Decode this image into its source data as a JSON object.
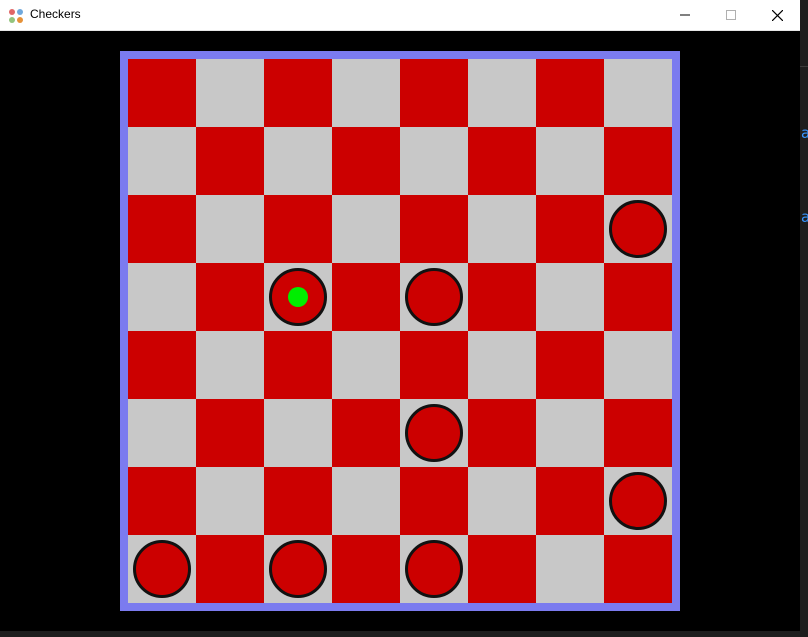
{
  "window": {
    "title": "Checkers",
    "icon": "checkers-app-icon",
    "minimize_icon": "minimize-icon",
    "maximize_icon": "maximize-icon",
    "close_icon": "close-icon"
  },
  "board": {
    "rows": 8,
    "cols": 8,
    "colors": {
      "dark_square": "#cc0000",
      "light_square": "#c8c8c8",
      "border": "#7b7bef",
      "piece_fill": "#cc0000",
      "piece_outline": "#111111",
      "selected_marker": "#00ee00"
    },
    "pieces": [
      {
        "row": 3,
        "col": 8,
        "color": "red",
        "selected": false
      },
      {
        "row": 4,
        "col": 3,
        "color": "red",
        "selected": true
      },
      {
        "row": 4,
        "col": 5,
        "color": "red",
        "selected": false
      },
      {
        "row": 6,
        "col": 5,
        "color": "red",
        "selected": false
      },
      {
        "row": 7,
        "col": 8,
        "color": "red",
        "selected": false
      },
      {
        "row": 8,
        "col": 1,
        "color": "red",
        "selected": false
      },
      {
        "row": 8,
        "col": 3,
        "color": "red",
        "selected": false
      },
      {
        "row": 8,
        "col": 5,
        "color": "red",
        "selected": false
      }
    ]
  },
  "background_window": {
    "glyphs": [
      "a",
      "a"
    ],
    "text_color": "#3794ff"
  }
}
